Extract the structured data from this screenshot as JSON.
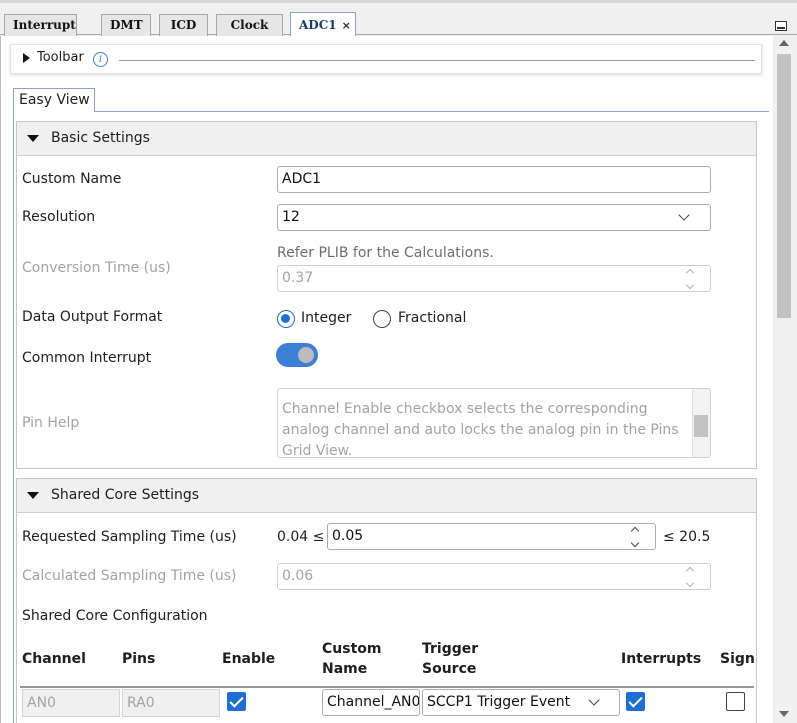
{
  "tabs": [
    {
      "label": "Interrupt"
    },
    {
      "label": "DMT"
    },
    {
      "label": "ICD"
    },
    {
      "label": "Clock"
    },
    {
      "label": "ADC1",
      "close": "×"
    }
  ],
  "toolbar": {
    "label": "Toolbar",
    "info_icon": "i"
  },
  "view_tab": "Easy View",
  "basic": {
    "title": "Basic Settings",
    "custom_name_label": "Custom Name",
    "custom_name_value": "ADC1",
    "resolution_label": "Resolution",
    "resolution_value": "12",
    "conversion_label": "Conversion Time (us)",
    "conversion_hint": "Refer PLIB for the Calculations.",
    "conversion_value": "0.37",
    "format_label": "Data Output Format",
    "format_options": [
      "Integer",
      "Fractional"
    ],
    "format_selected": "Integer",
    "common_interrupt_label": "Common Interrupt",
    "common_interrupt_on": true,
    "pin_help_label": "Pin Help",
    "pin_help_text": "Channel Enable checkbox selects the corresponding analog channel and auto locks the analog pin in the Pins Grid View."
  },
  "shared": {
    "title": "Shared Core Settings",
    "req_sampling_label": "Requested Sampling Time (us)",
    "req_min": "0.04 ≤",
    "req_value": "0.05",
    "req_max": "≤ 20.5",
    "calc_sampling_label": "Calculated Sampling Time (us)",
    "calc_value": "0.06",
    "config_label": "Shared Core Configuration",
    "columns": [
      "Channel",
      "Pins",
      "Enable",
      "Custom Name",
      "Trigger Source",
      "Interrupts",
      "Sign"
    ],
    "rows": [
      {
        "channel": "AN0",
        "pin": "RA0",
        "enable": true,
        "custom_name": "Channel_AN0",
        "trigger": "SCCP1 Trigger Event",
        "interrupts": true,
        "sign": false
      }
    ]
  }
}
